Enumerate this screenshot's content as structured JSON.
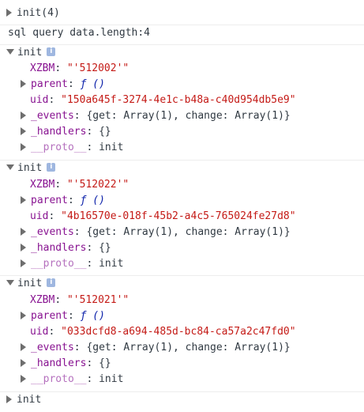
{
  "log1": "init(4)",
  "log2": "sql query data.length:4",
  "objects": [
    {
      "name": "init",
      "info_badge": "i",
      "xzbm_key": "XZBM",
      "xzbm_value": "\"'512002'\"",
      "parent_key": "parent",
      "parent_value": "ƒ ()",
      "uid_key": "uid",
      "uid_value": "\"150a645f-3274-4e1c-b48a-c40d954db5e9\"",
      "events_key": "_events",
      "events_value": "{get: Array(1), change: Array(1)}",
      "handlers_key": "_handlers",
      "handlers_value": "{}",
      "proto_key": "__proto__",
      "proto_value": "init"
    },
    {
      "name": "init",
      "info_badge": "i",
      "xzbm_key": "XZBM",
      "xzbm_value": "\"'512022'\"",
      "parent_key": "parent",
      "parent_value": "ƒ ()",
      "uid_key": "uid",
      "uid_value": "\"4b16570e-018f-45b2-a4c5-765024fe27d8\"",
      "events_key": "_events",
      "events_value": "{get: Array(1), change: Array(1)}",
      "handlers_key": "_handlers",
      "handlers_value": "{}",
      "proto_key": "__proto__",
      "proto_value": "init"
    },
    {
      "name": "init",
      "info_badge": "i",
      "xzbm_key": "XZBM",
      "xzbm_value": "\"'512021'\"",
      "parent_key": "parent",
      "parent_value": "ƒ ()",
      "uid_key": "uid",
      "uid_value": "\"033dcfd8-a694-485d-bc84-ca57a2c47fd0\"",
      "events_key": "_events",
      "events_value": "{get: Array(1), change: Array(1)}",
      "handlers_key": "_handlers",
      "handlers_value": "{}",
      "proto_key": "__proto__",
      "proto_value": "init"
    }
  ],
  "last": "init",
  "colors": {
    "key": "#881391",
    "string": "#c41a16",
    "function": "#0d22aa",
    "text": "#303942"
  }
}
